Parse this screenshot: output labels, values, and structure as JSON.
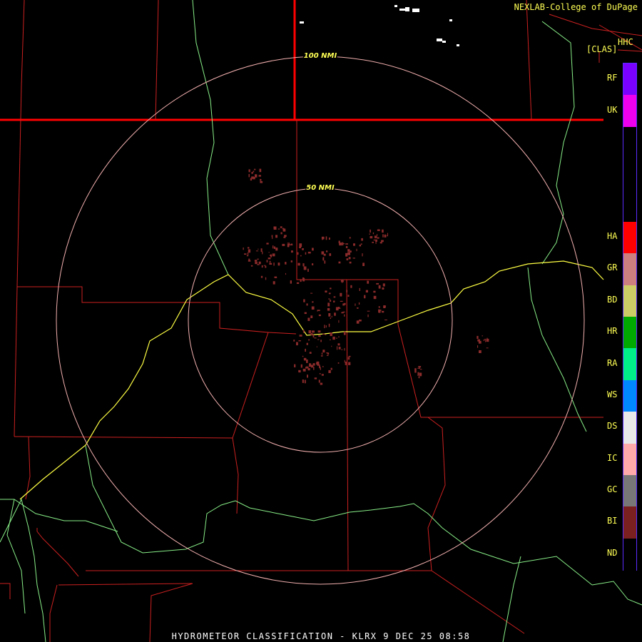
{
  "header": {
    "credit": "NEXLAB-College of DuPage",
    "product_code": "HHC",
    "product_tag": "[CLAS]"
  },
  "footer": {
    "title": "HYDROMETEOR CLASSIFICATION - KLRX 9 DEC 25 08:58"
  },
  "range_rings": [
    {
      "label": "100 NMI"
    },
    {
      "label": "50 NMI"
    }
  ],
  "legend": [
    {
      "code": "RF",
      "color": "#7a00ff"
    },
    {
      "code": "UK",
      "color": "#ee00ee"
    },
    {
      "code": "",
      "color": "#000000"
    },
    {
      "code": "",
      "color": "#000000"
    },
    {
      "code": "",
      "color": "#000000"
    },
    {
      "code": "HA",
      "color": "#ff0000"
    },
    {
      "code": "GR",
      "color": "#cc7f7f"
    },
    {
      "code": "BD",
      "color": "#cccc66"
    },
    {
      "code": "HR",
      "color": "#00aa00"
    },
    {
      "code": "RA",
      "color": "#00ee88"
    },
    {
      "code": "WS",
      "color": "#0088ff"
    },
    {
      "code": "DS",
      "color": "#e8e8e8"
    },
    {
      "code": "IC",
      "color": "#ffaaaa"
    },
    {
      "code": "GC",
      "color": "#777777"
    },
    {
      "code": "BI",
      "color": "#7a2020"
    },
    {
      "code": "ND",
      "color": "#000000"
    }
  ],
  "colors": {
    "state_border": "#ff0000",
    "county_line": "#cc2020",
    "highway": "#88ee88",
    "interstate": "#ffff44",
    "range_ring": "#f4b0b0",
    "echo": "#8b2b2b"
  }
}
